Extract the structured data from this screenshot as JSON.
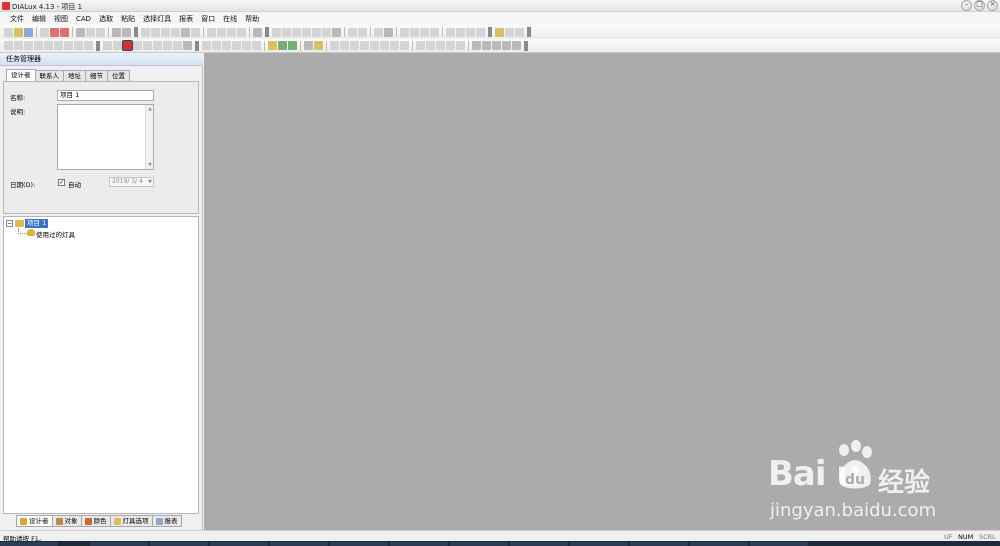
{
  "window": {
    "title": "DIALux 4.13 - 项目 1",
    "minimize": "–",
    "maximize": "□",
    "close": "×"
  },
  "menu": [
    "文件",
    "编辑",
    "视图",
    "CAD",
    "选取",
    "粘贴",
    "选择灯具",
    "报表",
    "窗口",
    "在线",
    "帮助"
  ],
  "task_manager": {
    "title": "任务管理器",
    "tabs": [
      "设计者",
      "联系人",
      "地址",
      "细节",
      "位置"
    ],
    "name_label": "名称:",
    "name_value": "项目 1",
    "desc_label": "说明:",
    "date_label": "日期(D):",
    "auto_label": "自动",
    "auto_checked": "✓",
    "date_value": "2019/ 3/ 4",
    "date_drop": "▼"
  },
  "tree": {
    "expander": "−",
    "root": "项目 1",
    "child": "使用过的灯具"
  },
  "bottom_tabs": [
    "设计者",
    "对象",
    "颜色",
    "灯具选项",
    "报表"
  ],
  "status": {
    "help": "帮助请按 F1。",
    "uf": "UF",
    "num": "NUM",
    "scrl": "SCRL"
  },
  "watermark": {
    "brand": "Bai  u",
    "cn": "经验",
    "url": "jingyan.baidu.com"
  },
  "colors": {
    "workspace": "#ababab",
    "selection": "#3b73c7",
    "folder": "#e9b84a"
  }
}
